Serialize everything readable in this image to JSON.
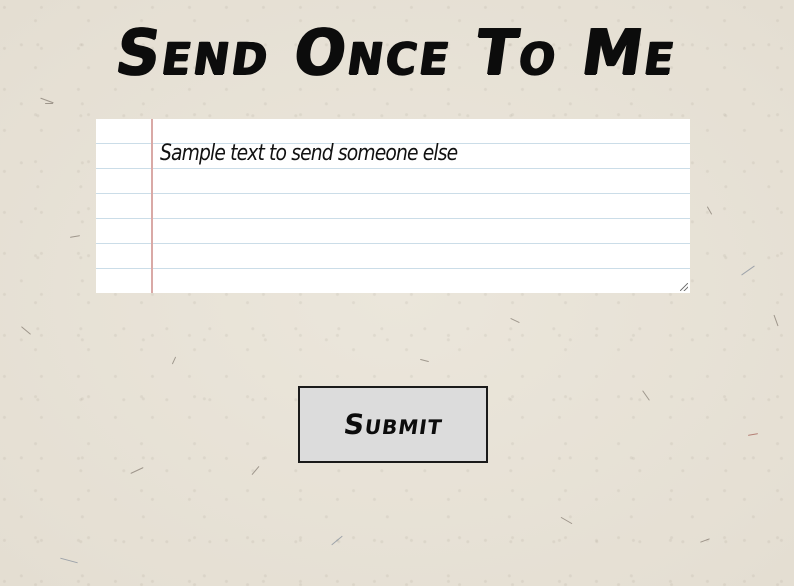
{
  "header": {
    "title": "Send Once To Me"
  },
  "message": {
    "value": "Sample text to send someone else"
  },
  "actions": {
    "submit_label": "Submit"
  },
  "colors": {
    "background": "#e8e3d8",
    "paper": "#ffffff",
    "ruled_line": "#cbdde8",
    "margin_line": "#d9a9a6",
    "button_fill": "#dcdcdc",
    "ink": "#0c0c0c"
  }
}
